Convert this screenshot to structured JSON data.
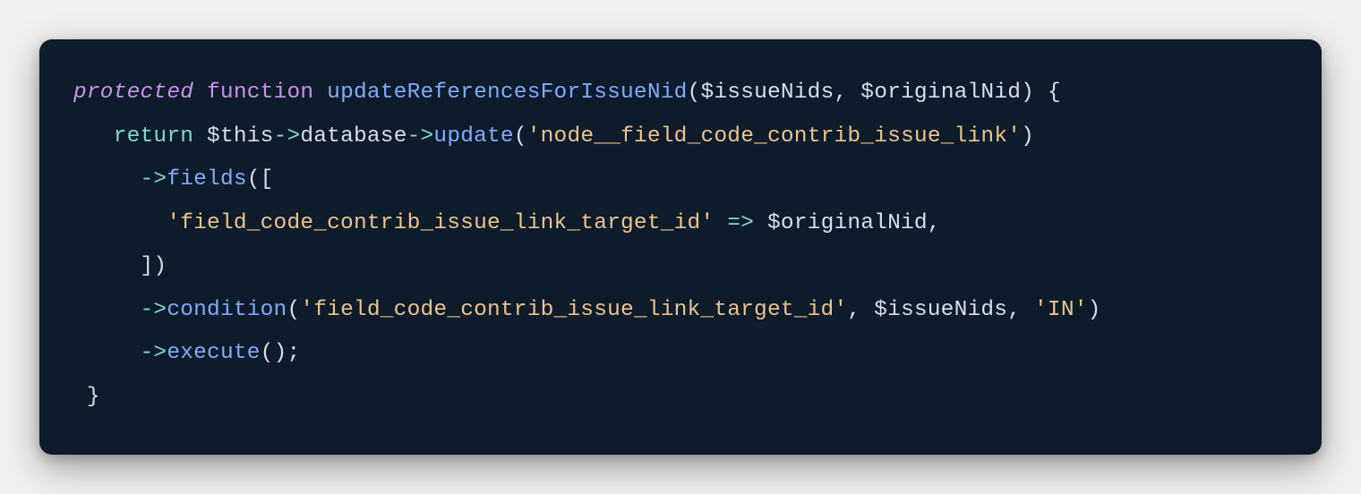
{
  "code": {
    "t_protected": "protected",
    "t_function": "function",
    "t_fn_name": "updateReferencesForIssueNid",
    "t_param1": "$issueNids",
    "t_param2": "$originalNid",
    "t_return": "return",
    "t_this": "$this",
    "t_database": "database",
    "t_update": "update",
    "t_str_table": "'node__field_code_contrib_issue_link'",
    "t_fields": "fields",
    "t_str_target": "'field_code_contrib_issue_link_target_id'",
    "t_fat_arrow": "=>",
    "t_originalNid": "$originalNid",
    "t_condition": "condition",
    "t_str_target2": "'field_code_contrib_issue_link_target_id'",
    "t_issueNids": "$issueNids",
    "t_str_in": "'IN'",
    "t_execute": "execute",
    "t_arrow": "->",
    "t_open_paren": "(",
    "t_close_paren": ")",
    "t_open_brace": "{",
    "t_close_brace": "}",
    "t_open_bracket": "[",
    "t_close_bracket": "]",
    "t_comma": ",",
    "t_semi": ";",
    "t_sp": " "
  }
}
